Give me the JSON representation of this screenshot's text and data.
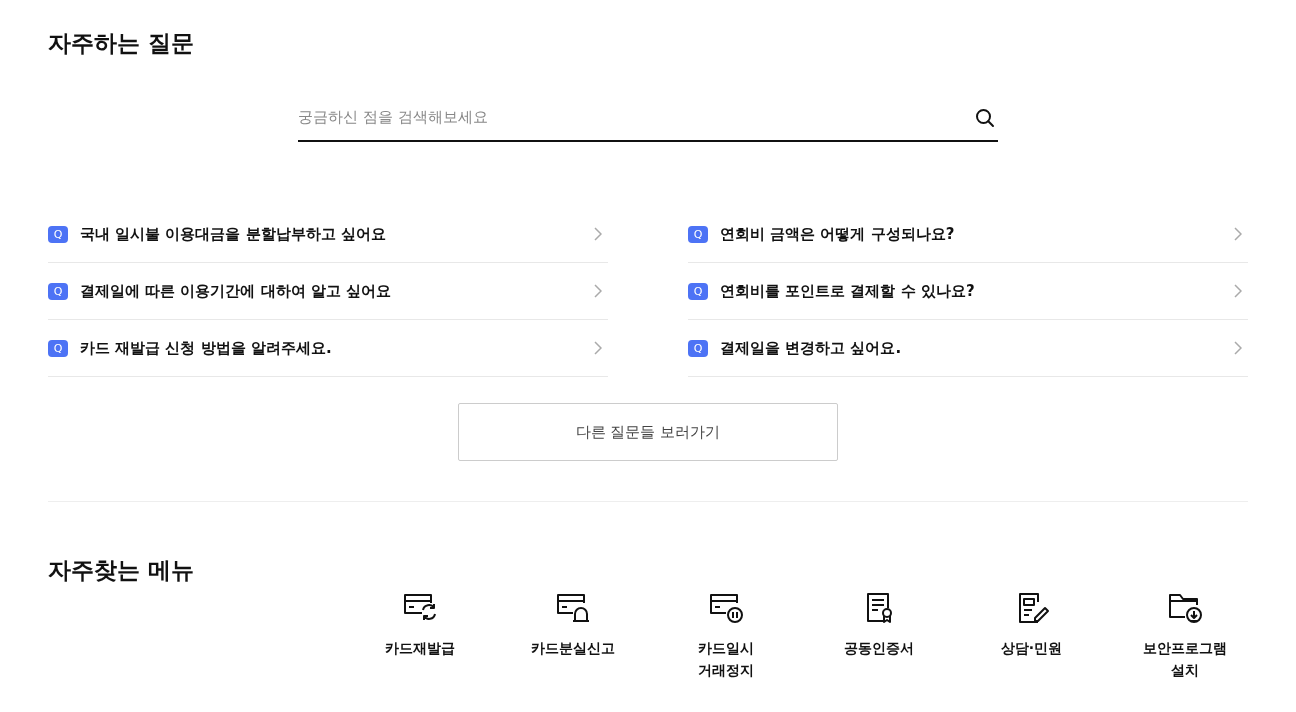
{
  "faq": {
    "title": "자주하는 질문",
    "search": {
      "placeholder": "궁금하신 점을 검색해보세요"
    },
    "questions": [
      {
        "badge": "Q",
        "text": "국내 일시불 이용대금을 분할납부하고 싶어요"
      },
      {
        "badge": "Q",
        "text": "연회비 금액은 어떻게 구성되나요?"
      },
      {
        "badge": "Q",
        "text": "결제일에 따른 이용기간에 대하여 알고 싶어요"
      },
      {
        "badge": "Q",
        "text": "연회비를 포인트로 결제할 수 있나요?"
      },
      {
        "badge": "Q",
        "text": "카드 재발급 신청 방법을 알려주세요."
      },
      {
        "badge": "Q",
        "text": "결제일을 변경하고 싶어요."
      }
    ],
    "more_button": "다른 질문들 보러가기"
  },
  "menu": {
    "title": "자주찾는 메뉴",
    "items": [
      {
        "kind": "reissue",
        "label": "카드재발급"
      },
      {
        "kind": "lost",
        "label": "카드분실신고"
      },
      {
        "kind": "suspend",
        "label": "카드일시\n거래정지"
      },
      {
        "kind": "certificate",
        "label": "공동인증서"
      },
      {
        "kind": "consult",
        "label": "상담·민원"
      },
      {
        "kind": "install",
        "label": "보안프로그램\n설치"
      }
    ]
  }
}
